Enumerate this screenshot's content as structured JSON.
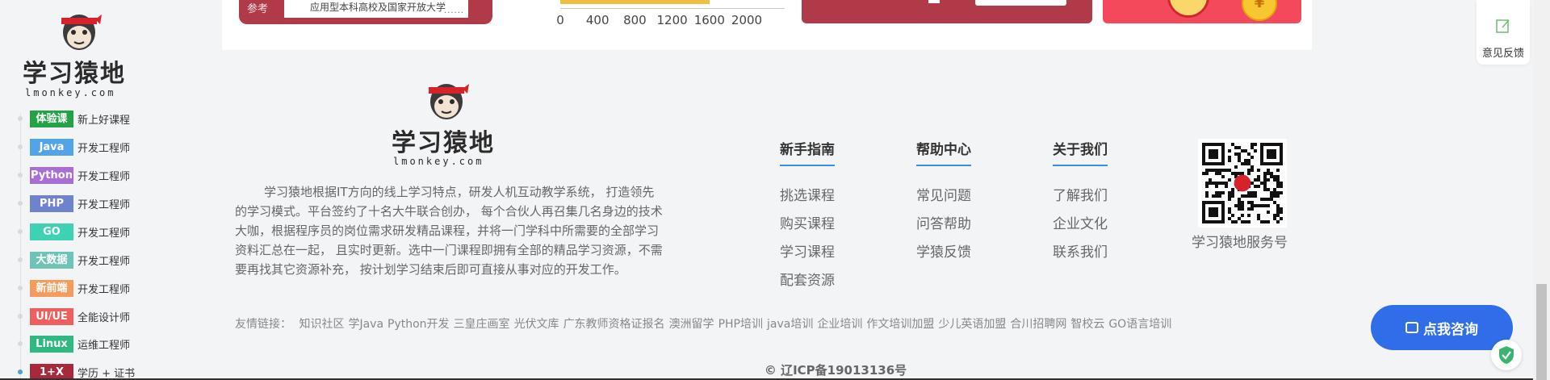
{
  "top_strip": {
    "register_label": "参考",
    "register_text": "应用型本科高校及国家开放大学",
    "register_dots": "......",
    "axis_ticks": [
      "0",
      "400",
      "800",
      "1200",
      "1600",
      "2000"
    ],
    "bar_value": 1600
  },
  "feedback": {
    "label": "意见反馈"
  },
  "brand": {
    "name": "学习猿地",
    "domain": "lmonkey.com"
  },
  "sidebar": {
    "items": [
      {
        "badge": "体验课",
        "text": "新上好课程",
        "color": "#24a246"
      },
      {
        "badge": "Java",
        "text": "开发工程师",
        "color": "#53a3e8"
      },
      {
        "badge": "Python",
        "text": "开发工程师",
        "color": "#a86ed6"
      },
      {
        "badge": "PHP",
        "text": "开发工程师",
        "color": "#6f82cc"
      },
      {
        "badge": "GO",
        "text": "开发工程师",
        "color": "#3ed1b3"
      },
      {
        "badge": "大数据",
        "text": "开发工程师",
        "color": "#6ec3b6"
      },
      {
        "badge": "新前端",
        "text": "开发工程师",
        "color": "#f59b5b"
      },
      {
        "badge": "UI/UE",
        "text": "全能设计师",
        "color": "#f05f5f"
      },
      {
        "badge": "Linux",
        "text": "运维工程师",
        "color": "#2fb882"
      },
      {
        "badge": "1+X",
        "text": "学历 + 证书",
        "color": "#a8283c"
      }
    ]
  },
  "footer": {
    "about": "学习猿地根据IT方向的线上学习特点，研发人机互动教学系统， 打造领先的学习模式。平台签约了十名大牛联合创办， 每个合伙人再召集几名身边的技术大咖，根据程序员的岗位需求研发精品课程，并将一门学科中所需要的全部学习资料汇总在一起， 且实时更新。选中一门课程即拥有全部的精品学习资源，不需要再找其它资源补充， 按计划学习结束后即可直接从事对应的开发工作。",
    "columns": [
      {
        "title": "新手指南",
        "links": [
          "挑选课程",
          "购买课程",
          "学习课程",
          "配套资源"
        ]
      },
      {
        "title": "帮助中心",
        "links": [
          "常见问题",
          "问答帮助",
          "学猿反馈"
        ]
      },
      {
        "title": "关于我们",
        "links": [
          "了解我们",
          "企业文化",
          "联系我们"
        ]
      }
    ],
    "qr_label": "学习猿地服务号",
    "friend_links_label": "友情链接：",
    "friend_links": [
      "知识社区",
      "学Java",
      "Python开发",
      "三皇庄画室",
      "光伏文库",
      "广东教师资格证报名",
      "澳洲留学",
      "PHP培训",
      "java培训",
      "企业培训",
      "作文培训加盟",
      "少儿英语加盟",
      "合川招聘网",
      "智校云",
      "GO语言培训"
    ],
    "icp": "© 辽ICP备19013136号"
  },
  "consult": {
    "label": "点我咨询"
  }
}
